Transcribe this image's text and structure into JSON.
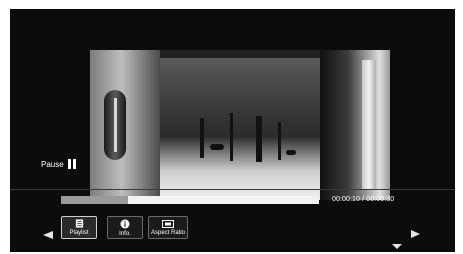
{
  "player": {
    "state_label": "Pause",
    "current_time": "00:00:10",
    "total_time": "00:00:30",
    "time_separator": " / ",
    "progress_fraction": 0.26
  },
  "menu": {
    "buttons": [
      {
        "label": "Playlist",
        "icon": "playlist-icon",
        "selected": true
      },
      {
        "label": "Info.",
        "icon": "info-icon",
        "selected": false
      },
      {
        "label": "Aspect Ratio",
        "icon": "aspect-ratio-icon",
        "selected": false
      }
    ]
  },
  "colors": {
    "background": "#0c0c0c",
    "progress_track": "#f2f2f2",
    "progress_fill": "#9a9a9a",
    "text": "#ffffff"
  }
}
